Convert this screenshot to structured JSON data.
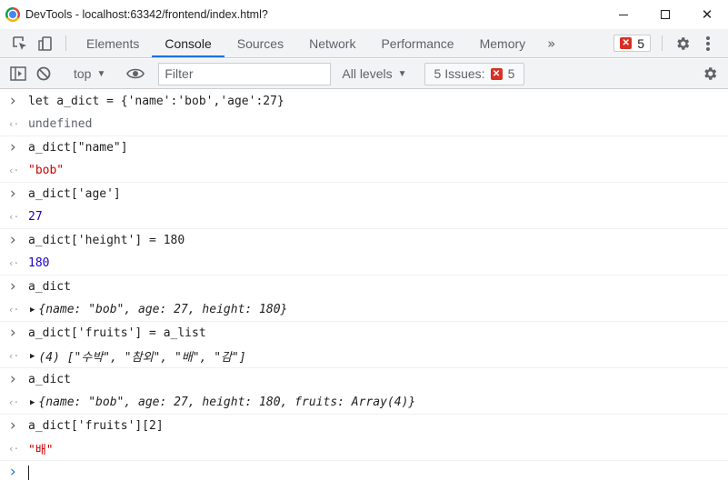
{
  "window": {
    "title": "DevTools - localhost:63342/frontend/index.html?"
  },
  "tabs": [
    "Elements",
    "Console",
    "Sources",
    "Network",
    "Performance",
    "Memory"
  ],
  "active_tab": "Console",
  "error_count": "5",
  "console_toolbar": {
    "context": "top",
    "filter_placeholder": "Filter",
    "levels": "All levels",
    "issues_label": "5 Issues:",
    "issues_count": "5"
  },
  "entries": [
    {
      "input": "let a_dict = {'name':'bob','age':27}",
      "output": "undefined"
    },
    {
      "input": "a_dict[\"name\"]",
      "output": "\"bob\""
    },
    {
      "input": "a_dict['age']",
      "output": "27"
    },
    {
      "input": "a_dict['height'] = 180",
      "output": "180"
    },
    {
      "input": "a_dict",
      "output": "{name: \"bob\", age: 27, height: 180}"
    },
    {
      "input": "a_dict['fruits'] = a_list",
      "output": "(4) [\"수박\", \"참외\", \"배\", \"감\"]"
    },
    {
      "input": "a_dict",
      "output": "{name: \"bob\", age: 27, height: 180, fruits: Array(4)}"
    },
    {
      "input": "a_dict['fruits'][2]",
      "output": "\"배\""
    }
  ],
  "colors": {
    "accent": "#1a73e8",
    "string": "#c80000",
    "number": "#1c00cf",
    "error": "#d93025"
  }
}
